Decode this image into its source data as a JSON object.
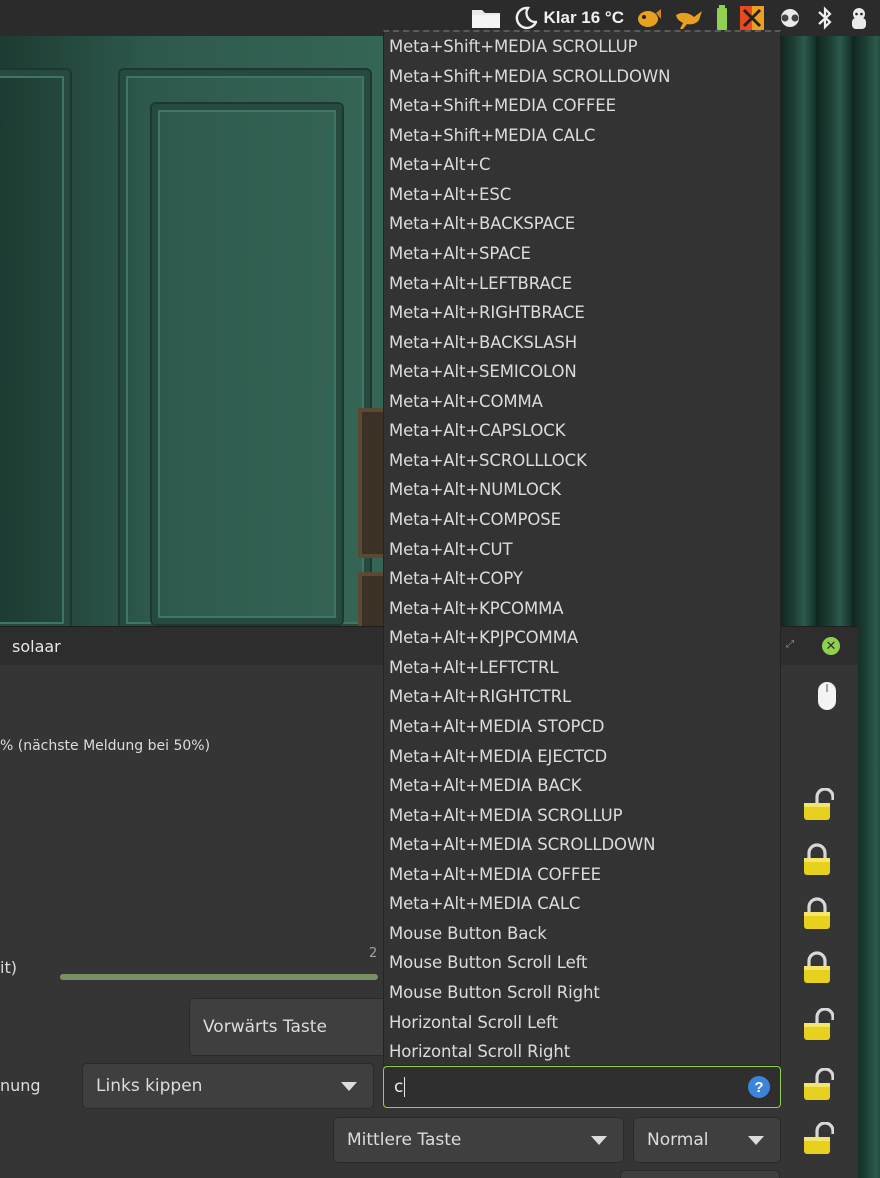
{
  "topbar": {
    "weather": "Klar 16 °C"
  },
  "window": {
    "title": "solaar",
    "status": "% (nächste Meldung bei 50%)",
    "label_left_1": "it)",
    "label_left_2": "nung",
    "slider_value": "2"
  },
  "controls": {
    "forward_button": "Vorwärts Taste",
    "tilt_select": "Links kippen",
    "entry_value": "c",
    "middle_select": "Mittlere Taste",
    "normal_select": "Normal"
  },
  "popup": {
    "items": [
      "Meta+Shift+MEDIA SCROLLUP",
      "Meta+Shift+MEDIA SCROLLDOWN",
      "Meta+Shift+MEDIA COFFEE",
      "Meta+Shift+MEDIA CALC",
      "Meta+Alt+C",
      "Meta+Alt+ESC",
      "Meta+Alt+BACKSPACE",
      "Meta+Alt+SPACE",
      "Meta+Alt+LEFTBRACE",
      "Meta+Alt+RIGHTBRACE",
      "Meta+Alt+BACKSLASH",
      "Meta+Alt+SEMICOLON",
      "Meta+Alt+COMMA",
      "Meta+Alt+CAPSLOCK",
      "Meta+Alt+SCROLLLOCK",
      "Meta+Alt+NUMLOCK",
      "Meta+Alt+COMPOSE",
      "Meta+Alt+CUT",
      "Meta+Alt+COPY",
      "Meta+Alt+KPCOMMA",
      "Meta+Alt+KPJPCOMMA",
      "Meta+Alt+LEFTCTRL",
      "Meta+Alt+RIGHTCTRL",
      "Meta+Alt+MEDIA STOPCD",
      "Meta+Alt+MEDIA EJECTCD",
      "Meta+Alt+MEDIA BACK",
      "Meta+Alt+MEDIA SCROLLUP",
      "Meta+Alt+MEDIA SCROLLDOWN",
      "Meta+Alt+MEDIA COFFEE",
      "Meta+Alt+MEDIA CALC",
      "Mouse Button Back",
      "Mouse Button Scroll Left",
      "Mouse Button Scroll Right",
      "Horizontal Scroll Left",
      "Horizontal Scroll Right"
    ]
  },
  "colors": {
    "accent": "#8fd14f",
    "lock": "#e6d21e"
  },
  "icons": {
    "locks": [
      "unlocked",
      "locked",
      "locked",
      "locked",
      "unlocked",
      "unlocked",
      "unlocked"
    ]
  }
}
